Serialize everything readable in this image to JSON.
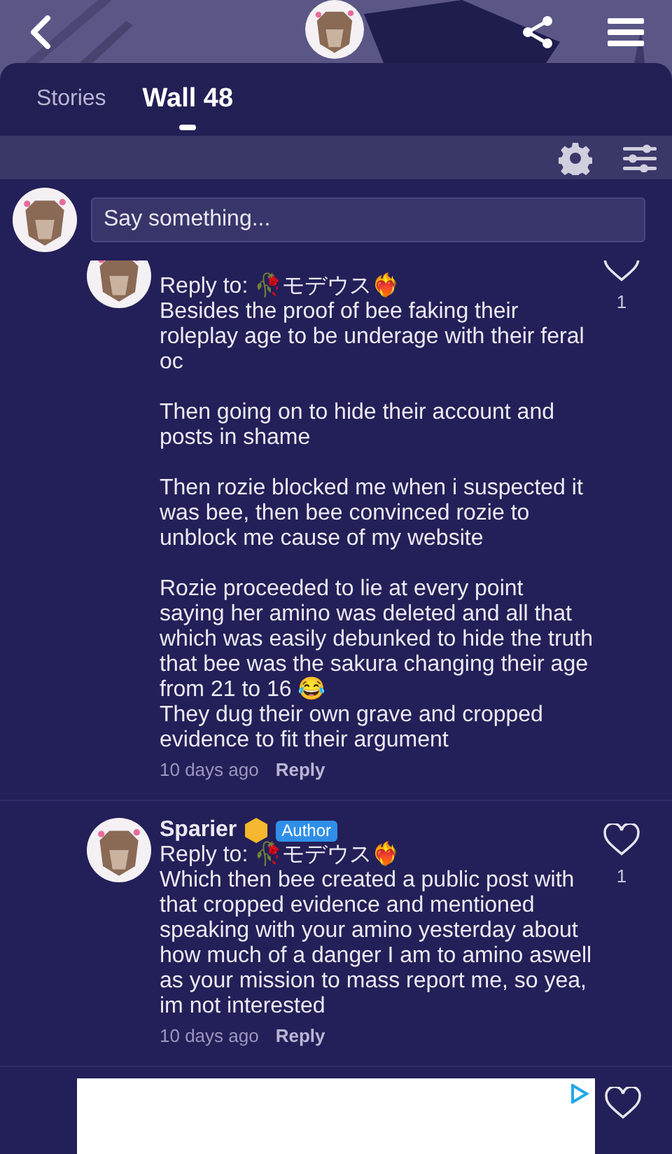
{
  "tabs": [
    {
      "label": "Stories",
      "selected": false
    },
    {
      "label": "Wall 48",
      "selected": true
    }
  ],
  "compose": {
    "placeholder": "Say something..."
  },
  "comments": [
    {
      "reply_to": "Reply to: 🥀モデウス❤️‍🔥",
      "body": "Besides the proof of bee faking their roleplay age to be underage with their feral oc\n\nThen going on to hide their account and posts in shame\n\nThen rozie blocked me when i suspected it was bee, then bee convinced rozie to unblock me cause of my website\n\nRozie proceeded to lie at every point saying her amino was deleted and all that which was easily debunked to hide the truth that bee was the sakura changing their age from 21 to 16 😂\nThey dug their own grave and cropped evidence to fit their argument",
      "time": "10 days ago",
      "reply": "Reply",
      "likes": "1"
    },
    {
      "name": "Sparier",
      "badge": "Author",
      "reply_to": "Reply to: 🥀モデウス❤️‍🔥",
      "body": "Which then bee created a public post with that cropped evidence and mentioned speaking with your amino yesterday about how much of a danger I am to amino aswell as your mission to mass report me, so yea, im not interested",
      "time": "10 days ago",
      "reply": "Reply",
      "likes": "1"
    }
  ]
}
